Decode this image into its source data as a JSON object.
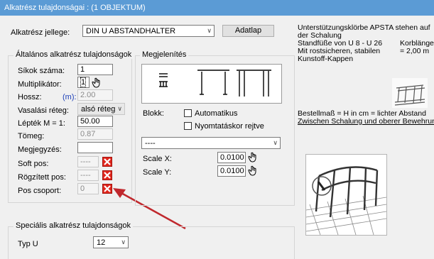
{
  "window": {
    "title": "Alkatrész tulajdonságai : (1 OBJEKTUM)"
  },
  "part_type": {
    "label": "Alkatrész jellege:",
    "value": "DIN U ABSTANDHALTER",
    "button": "Adatlap"
  },
  "general": {
    "title": "Általános alkatrész tulajdonságok",
    "levels_label": "Síkok száma:",
    "levels_value": "1",
    "multiplier_label": "Multiplikátor:",
    "multiplier_value": "1",
    "length_label": "Hossz:",
    "length_unit": "(m):",
    "length_value": "2.00",
    "rebar_layer_label": "Vasalási réteg:",
    "rebar_layer_value": "alsó réteg",
    "scale_label": "Lépték M = 1:",
    "scale_value": "50.00",
    "weight_label": "Tömeg:",
    "weight_value": "0.87",
    "note_label": "Megjegyzés:",
    "note_value": "",
    "soft_pos_label": "Soft pos:",
    "soft_pos_value": "----",
    "fixed_pos_label": "Rögzített pos:",
    "fixed_pos_value": "----",
    "pos_group_label": "Pos csoport:",
    "pos_group_value": "0"
  },
  "display": {
    "title": "Megjelenítés",
    "block_label": "Blokk:",
    "automatic_label": "Automatikus",
    "hide_print_label": "Nyomtatáskor rejtve",
    "layer_value": "----",
    "scale_x_label": "Scale X:",
    "scale_x_value": "0.0100",
    "scale_y_label": "Scale Y:",
    "scale_y_value": "0.0100"
  },
  "description": {
    "line1": "Unterstützungsklörbe APSTA stehen auf",
    "line2": "der Schalung",
    "line3a": "Standfüße von U  8 - U 26",
    "line3b": "Korblänge",
    "line4a": "Mit rostsicheren, stabilen",
    "line4b": "= 2,00 m",
    "line5": "Kunstoff-Kappen",
    "order1": "Bestellmaß = H in cm = lichter Abstand",
    "order2": "Zwischen Schalung und oberer Bewehrung"
  },
  "special": {
    "title": "Speciális alkatrész tulajdonságok",
    "typ_label": "Typ U",
    "typ_value": "12"
  },
  "colors": {
    "titlebar": "#5b9bd5",
    "delete_red": "#e0261d",
    "arrow_red": "#c0282d"
  }
}
